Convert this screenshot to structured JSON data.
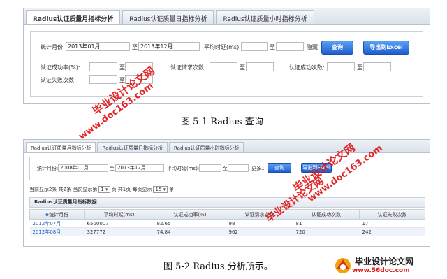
{
  "figure1": {
    "tabs": [
      "Radius认证质量月指标分析",
      "Radius认证质量日指标分析",
      "Radius认证质量小时指标分析"
    ],
    "form": {
      "month_label": "统计月份:",
      "month_from": "2013年01月",
      "month_to_sep": "至",
      "month_to": "2013年12月",
      "delay_label": "平均时延(ms):",
      "delay_sep": "至",
      "hide_label": "隐藏",
      "success_rate_label": "认证成功率(%):",
      "success_rate_sep": "至",
      "req_count_label": "认证请求次数:",
      "req_count_sep": "至",
      "success_count_label": "认证成功次数:",
      "success_count_sep": "至",
      "fail_count_label": "认证失败次数:",
      "fail_count_sep": "至",
      "query_button": "查询",
      "export_button": "导出到Excel"
    },
    "caption": "图 5-1    Radius 查询"
  },
  "figure2": {
    "tabs": [
      "Radius认证质量月指标分析",
      "Radius认证质量日指标分析",
      "Radius认证质量小时指标分析"
    ],
    "form": {
      "month_label": "统计月份:",
      "month_from": "2008年01月",
      "month_to_sep": "至",
      "month_to": "2013年12月",
      "delay_label": "平均时延(ms):",
      "delay_sep": "至",
      "more_label": "更多...",
      "query_button": "查询",
      "export_button": "导出到Excel"
    },
    "pager": {
      "prefix": "当前显示2条  共2条  当前显示第",
      "page": "1",
      "mid": "页 共1页  每页显示",
      "page_size": "15",
      "suffix": "条"
    },
    "grid": {
      "title": "Radius认证质量月指标数据",
      "columns": [
        "统计月份",
        "平均时延(ms)",
        "认证成功率(%)",
        "认证请求次数",
        "认证成功次数",
        "认证失败次数"
      ],
      "rows": [
        [
          "2012年07月",
          "6500007",
          "82.65",
          "98",
          "81",
          "17"
        ],
        [
          "2012年08月",
          "327772",
          "74.84",
          "962",
          "720",
          "242"
        ]
      ]
    },
    "caption": "图 5-2    Radius 分析所示。"
  },
  "watermarks": {
    "title_cn": "毕业设计论文网",
    "url": "www.doc163.com"
  },
  "logo": {
    "name": "毕业设计论文网",
    "url": "www.56doc.com"
  },
  "colors": {
    "watermark": "#e01010",
    "button_blue": "#2a6fe0",
    "link_blue": "#2a5db0"
  }
}
